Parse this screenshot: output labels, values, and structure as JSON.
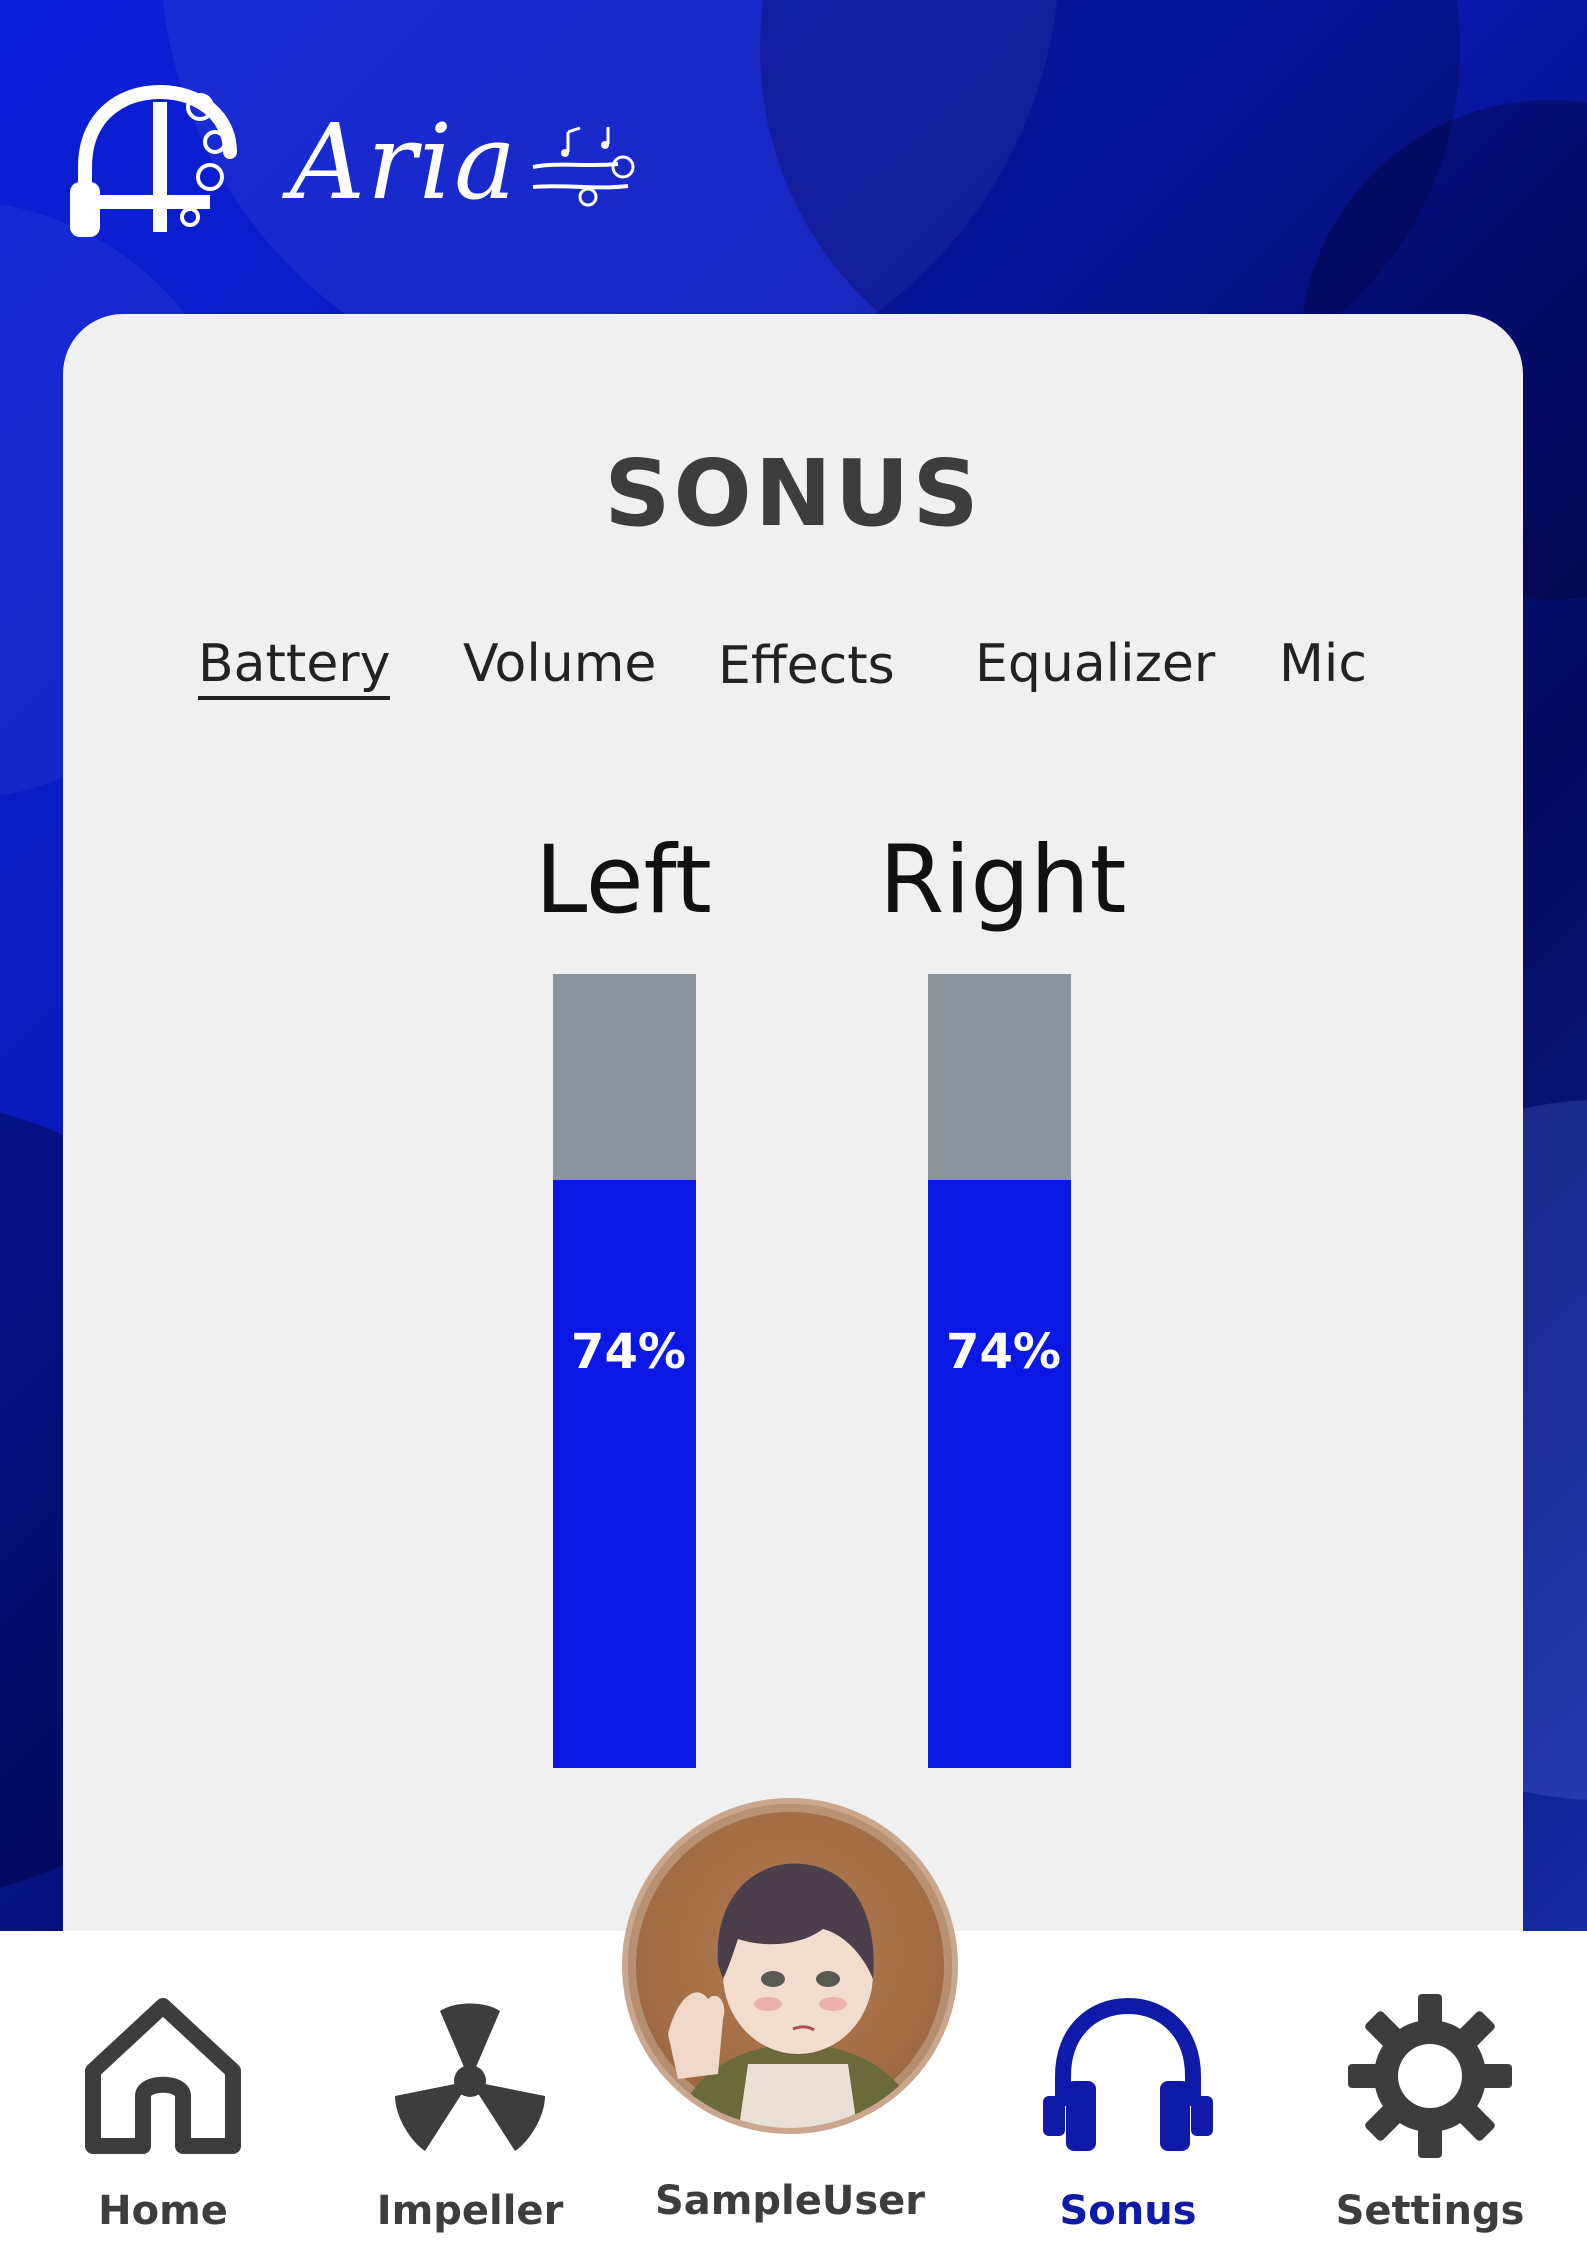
{
  "app": {
    "logo_text": "Aria"
  },
  "page": {
    "title": "SONUS"
  },
  "tabs": [
    {
      "label": "Battery",
      "active": true
    },
    {
      "label": "Volume",
      "active": false
    },
    {
      "label": "Effects",
      "active": false
    },
    {
      "label": "Equalizer",
      "active": false
    },
    {
      "label": "Mic",
      "active": false
    }
  ],
  "battery": {
    "left": {
      "label": "Left",
      "level_percent": 74,
      "value_text": "74%"
    },
    "right": {
      "label": "Right",
      "level_percent": 74,
      "value_text": "74%"
    }
  },
  "colors": {
    "accent": "#0b18e4",
    "bar_empty": "#8d949e",
    "nav_active": "#0f1aa8",
    "text_dark": "#3d3d3d"
  },
  "nav": {
    "items": [
      {
        "label": "Home",
        "icon": "home-icon",
        "active": false
      },
      {
        "label": "Impeller",
        "icon": "impeller-icon",
        "active": false
      },
      {
        "label": "SampleUser",
        "icon": "avatar",
        "active": false
      },
      {
        "label": "Sonus",
        "icon": "headphones-icon",
        "active": true
      },
      {
        "label": "Settings",
        "icon": "gear-icon",
        "active": false
      }
    ]
  }
}
